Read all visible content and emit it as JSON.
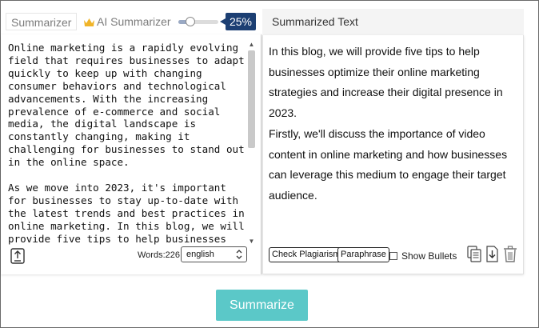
{
  "header": {
    "tab_summarizer": "Summarizer",
    "tab_ai_summarizer": "AI Summarizer",
    "summary_length_percent": "25%",
    "summary_length_value": 0.25
  },
  "input": {
    "text": "Online marketing is a rapidly evolving field that requires businesses to adapt quickly to keep up with changing consumer behaviors and technological advancements. With the increasing prevalence of e-commerce and social media, the digital landscape is constantly changing, making it challenging for businesses to stand out in the online space.\n\nAs we move into 2023, it's important for businesses to stay up-to-date with the latest trends and best practices in online marketing. In this blog, we will provide five tips to help businesses optimize their online marketing strategies and",
    "word_count_label": "Words:226",
    "language": "english"
  },
  "output": {
    "title": "Summarized Text",
    "paragraphs": [
      "In this blog, we will provide five tips to help businesses optimize their online marketing strategies and increase their digital presence in 2023.",
      "Firstly, we'll discuss the importance of video content in online marketing and how businesses can leverage this medium to engage their target audience."
    ],
    "check_plagiarism_label": "Check Plagiarism",
    "paraphrase_label": "Paraphrase",
    "show_bullets_label": "Show Bullets",
    "show_bullets_checked": false
  },
  "actions": {
    "summarize_label": "Summarize"
  },
  "colors": {
    "accent_teal": "#5bc8c8",
    "badge_navy": "#1c3f73",
    "crown_gold": "#f0b429"
  },
  "icons": [
    "crown-icon",
    "upload-icon",
    "copy-icon",
    "download-icon",
    "trash-icon",
    "chevron-up-down-icon"
  ]
}
